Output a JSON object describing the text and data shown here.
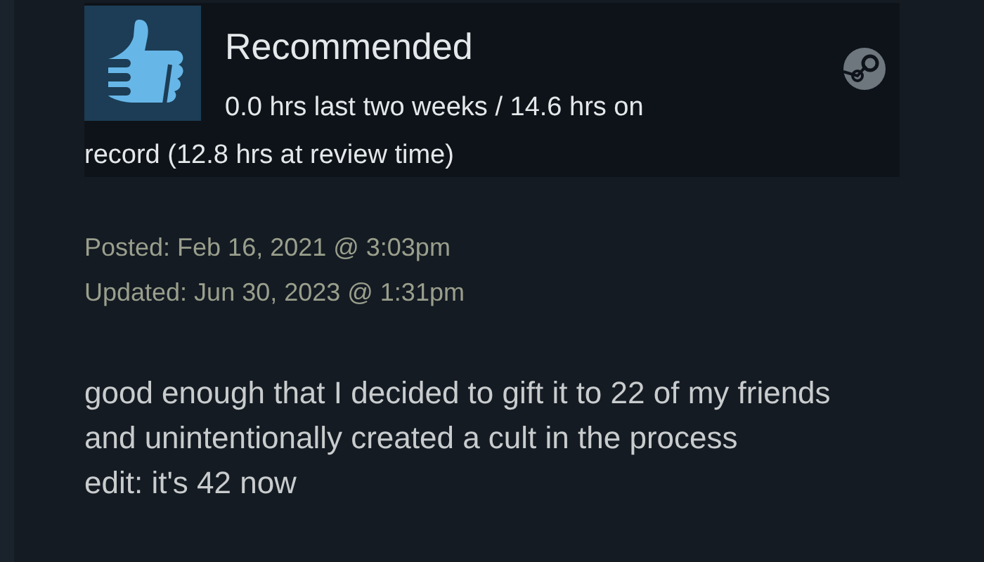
{
  "review": {
    "recommended": true,
    "title": "Recommended",
    "hours": "0.0 hrs last two weeks / 14.6 hrs on record (12.8 hrs at review time)",
    "posted": "Posted: Feb 16, 2021 @ 3:03pm",
    "updated": "Updated: Jun 30, 2023 @ 1:31pm",
    "body": [
      "good enough that I decided to gift it to 22 of my friends and unintentionally created a cult in the process",
      "edit: it's 42 now"
    ]
  }
}
